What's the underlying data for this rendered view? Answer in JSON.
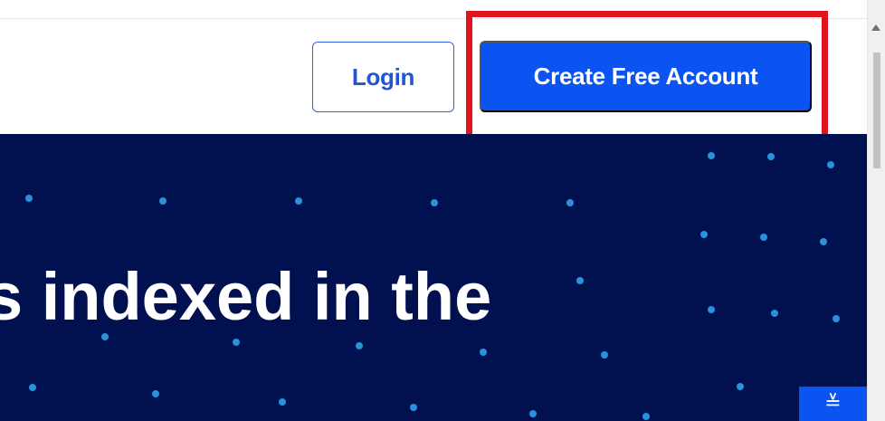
{
  "header": {
    "login_label": "Login",
    "create_account_label": "Create Free Account"
  },
  "hero": {
    "headline_fragment": "s indexed in the"
  },
  "widget": {
    "icon_glyph": "≚"
  },
  "colors": {
    "primary_blue": "#0b54f2",
    "outline_blue": "#2a67d8",
    "hero_bg": "#01114f",
    "dot": "#2b91d8",
    "highlight": "#e0141e"
  }
}
